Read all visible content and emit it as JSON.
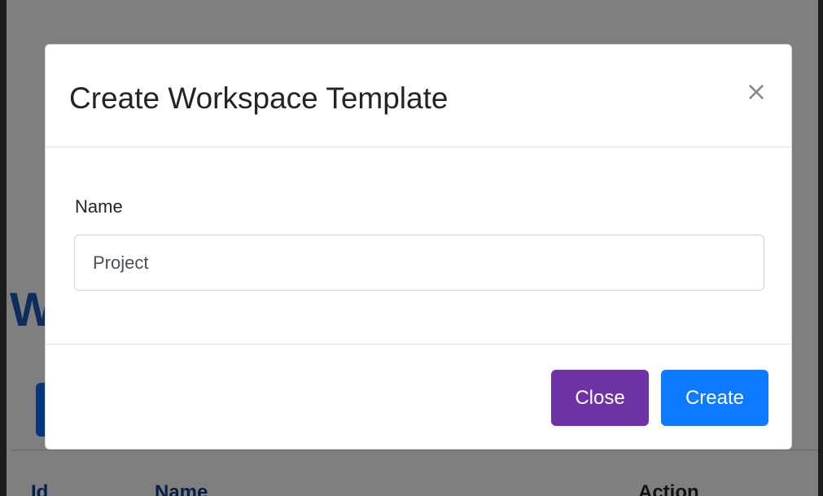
{
  "page": {
    "heading_fragment": "W",
    "table_headers": [
      "Id",
      "Name",
      "Action"
    ]
  },
  "modal": {
    "title": "Create Workspace Template",
    "close_icon": "×",
    "name_field": {
      "label": "Name",
      "value": "Project"
    },
    "buttons": {
      "close_label": "Close",
      "create_label": "Create"
    }
  },
  "colors": {
    "close_button": "#6f33a8",
    "create_button": "#0d7bff",
    "heading": "#1a5cb8"
  },
  "icons": {
    "close": "close-icon"
  }
}
